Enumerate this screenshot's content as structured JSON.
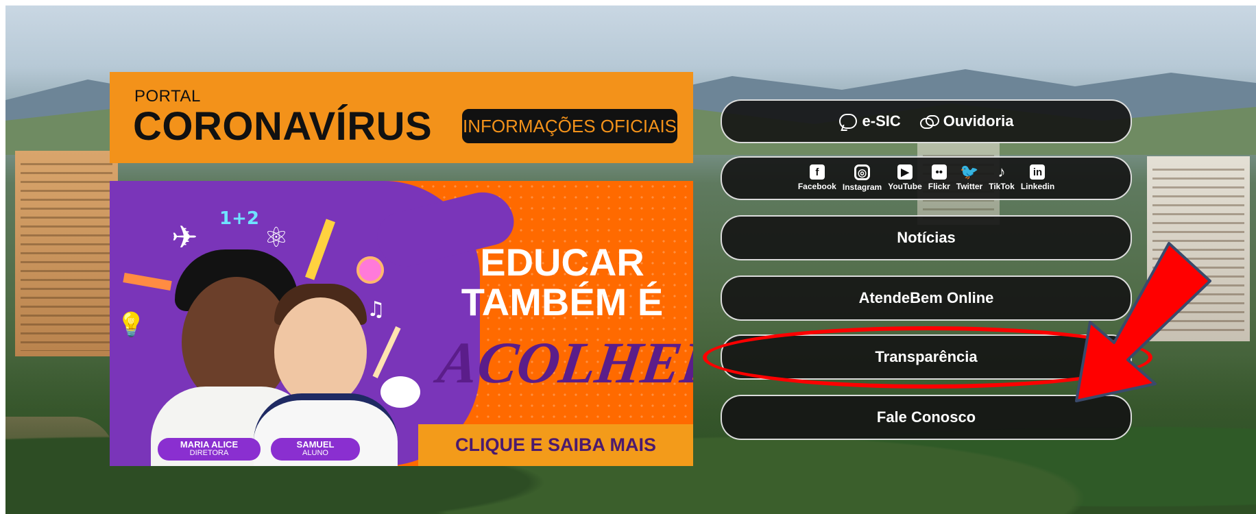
{
  "portal": {
    "small": "PORTAL",
    "big": "CORONAVÍRUS",
    "pill": "INFORMAÇÕES OFICIAIS",
    "color": "#f3921a"
  },
  "educar": {
    "line1": "EDUCAR",
    "line2": "TAMBÉM É",
    "line3": "ACOLHER",
    "cta": "CLIQUE E SAIBA MAIS",
    "person1_name": "MARIA ALICE",
    "person1_role": "DIRETORA",
    "person2_name": "SAMUEL",
    "person2_role": "ALUNO",
    "math": "1+2",
    "bg": "#ff6a00",
    "purple": "#7a35b9"
  },
  "menu": {
    "esic": "e-SIC",
    "ouvidoria": "Ouvidoria",
    "socials": [
      {
        "label": "Facebook",
        "icon": "f"
      },
      {
        "label": "Instagram",
        "icon": "◎"
      },
      {
        "label": "YouTube",
        "icon": "▶"
      },
      {
        "label": "Flickr",
        "icon": "••"
      },
      {
        "label": "Twitter",
        "icon": "🐦"
      },
      {
        "label": "TikTok",
        "icon": "♪"
      },
      {
        "label": "Linkedin",
        "icon": "in"
      }
    ],
    "noticias": "Notícias",
    "atendebem": "AtendeBem Online",
    "transparencia": "Transparência",
    "fale": "Fale Conosco"
  },
  "annotation": {
    "color": "#ff0000"
  }
}
